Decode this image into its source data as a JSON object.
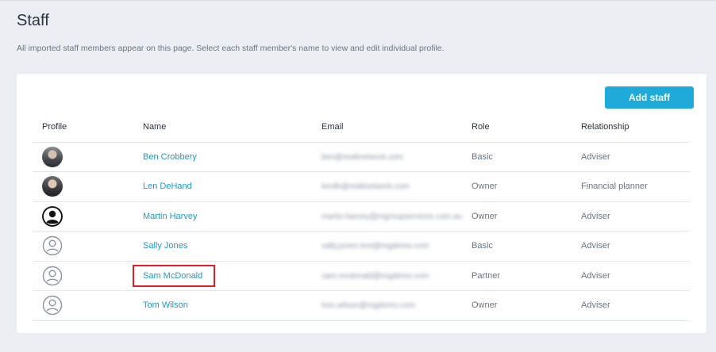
{
  "page": {
    "title": "Staff",
    "description": "All imported staff members appear on this page. Select each staff member's name to view and edit individual profile."
  },
  "toolbar": {
    "add_staff_label": "Add staff"
  },
  "table": {
    "headers": [
      "Profile",
      "Name",
      "Email",
      "Role",
      "Relationship"
    ],
    "rows": [
      {
        "name": "Ben Crobbery",
        "email": "ben@realtnetwork.com",
        "role": "Basic",
        "relationship": "Adviser",
        "avatar": "photo"
      },
      {
        "name": "Len DeHand",
        "email": "lendh@realtnetwork.com",
        "role": "Owner",
        "relationship": "Financial planner",
        "avatar": "photo"
      },
      {
        "name": "Martin Harvey",
        "email": "martin.harvey@mgroupservices.com.au",
        "role": "Owner",
        "relationship": "Adviser",
        "avatar": "person-icon-filled"
      },
      {
        "name": "Sally Jones",
        "email": "sally.jones.test@mgdemo.com",
        "role": "Basic",
        "relationship": "Adviser",
        "avatar": "person-icon-outline"
      },
      {
        "name": "Sam McDonald",
        "email": "sam.mcdonald@mgdemo.com",
        "role": "Partner",
        "relationship": "Adviser",
        "avatar": "person-icon-outline"
      },
      {
        "name": "Tom Wilson",
        "email": "tom.wilson@mgdemo.com",
        "role": "Owner",
        "relationship": "Adviser",
        "avatar": "person-icon-outline"
      }
    ]
  },
  "colors": {
    "accent": "#1eabd9",
    "link": "#1e9bc7",
    "highlight_border": "#e21d25",
    "background": "#ebeef2"
  }
}
